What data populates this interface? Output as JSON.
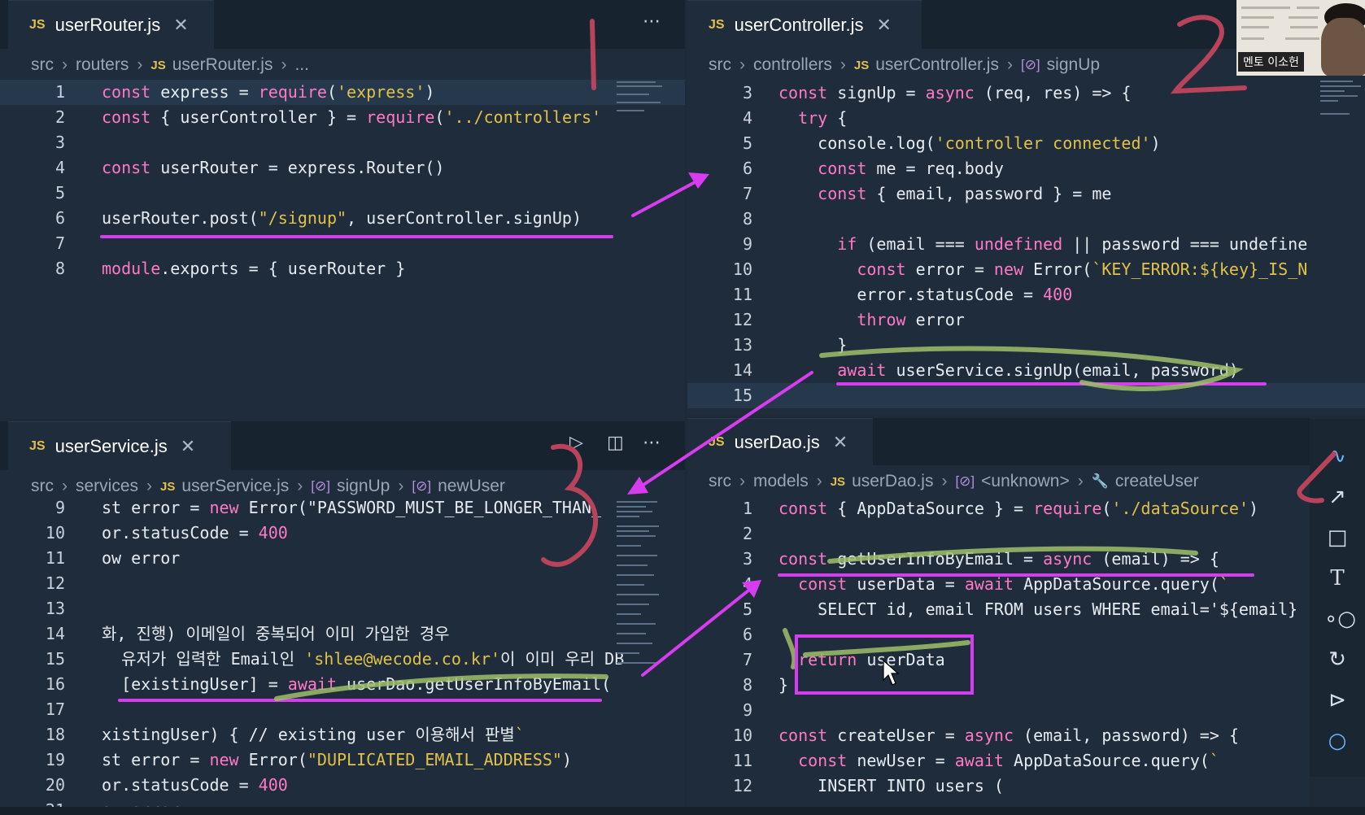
{
  "colors": {
    "keyword": "#ff79c6",
    "string": "#e2c14a",
    "func": "#ffb86c",
    "plain": "#e6ebf1",
    "comment": "#6aa1e0",
    "number": "#ff79c6",
    "annotation": "#d83cf0"
  },
  "pane1": {
    "tab": {
      "icon": "JS",
      "label": "userRouter.js"
    },
    "more_icon": "more-icon",
    "breadcrumb": [
      "src",
      "routers",
      "userRouter.js",
      "..."
    ],
    "lines": [
      {
        "n": "1",
        "t": "const express = require('express')"
      },
      {
        "n": "2",
        "t": "const { userController } = require('../controllers'"
      },
      {
        "n": "3",
        "t": ""
      },
      {
        "n": "4",
        "t": "const userRouter = express.Router()"
      },
      {
        "n": "5",
        "t": ""
      },
      {
        "n": "6",
        "t": "userRouter.post(\"/signup\", userController.signUp)"
      },
      {
        "n": "7",
        "t": ""
      },
      {
        "n": "8",
        "t": "module.exports = { userRouter }"
      }
    ]
  },
  "pane2": {
    "tab": {
      "icon": "JS",
      "label": "userController.js"
    },
    "breadcrumb": [
      "src",
      "controllers",
      "userController.js",
      "signUp"
    ],
    "lines": [
      {
        "n": "3",
        "t": "const signUp = async (req, res) => {"
      },
      {
        "n": "4",
        "t": "  try {"
      },
      {
        "n": "5",
        "t": "    console.log('controller connected')"
      },
      {
        "n": "6",
        "t": "    const me = req.body"
      },
      {
        "n": "7",
        "t": "    const { email, password } = me"
      },
      {
        "n": "8",
        "t": ""
      },
      {
        "n": "9",
        "t": "      if (email === undefined || password === undefine"
      },
      {
        "n": "10",
        "t": "        const error = new Error(`KEY_ERROR:${key}_IS_N"
      },
      {
        "n": "11",
        "t": "        error.statusCode = 400"
      },
      {
        "n": "12",
        "t": "        throw error"
      },
      {
        "n": "13",
        "t": "      }"
      },
      {
        "n": "14",
        "t": "      await userService.signUp(email, password)"
      },
      {
        "n": "15",
        "t": ""
      }
    ]
  },
  "pane3": {
    "tab": {
      "icon": "JS",
      "label": "userService.js"
    },
    "breadcrumb": [
      "src",
      "services",
      "userService.js",
      "signUp",
      "newUser"
    ],
    "lines": [
      {
        "n": "9",
        "t": "st error = new Error(\"PASSWORD_MUST_BE_LONGER_THAN_"
      },
      {
        "n": "10",
        "t": "or.statusCode = 400"
      },
      {
        "n": "11",
        "t": "ow error"
      },
      {
        "n": "12",
        "t": ""
      },
      {
        "n": "13",
        "t": ""
      },
      {
        "n": "14",
        "t": "화, 진행) 이메일이 중복되어 이미 가입한 경우"
      },
      {
        "n": "15",
        "t": "  유저가 입력한 Email인 'shlee@wecode.co.kr'이 이미 우리 DB"
      },
      {
        "n": "16",
        "t": "  [existingUser] = await userDao.getUserInfoByEmail("
      },
      {
        "n": "17",
        "t": ""
      },
      {
        "n": "18",
        "t": "xistingUser) { // existing user 이용해서 판별`"
      },
      {
        "n": "19",
        "t": "st error = new Error(\"DUPLICATED_EMAIL_ADDRESS\")"
      },
      {
        "n": "20",
        "t": "or.statusCode = 400"
      },
      {
        "n": "21",
        "t": "ow error"
      }
    ]
  },
  "pane4": {
    "tab": {
      "icon": "JS",
      "label": "userDao.js"
    },
    "breadcrumb": [
      "src",
      "models",
      "userDao.js",
      "<unknown>",
      "createUser"
    ],
    "lines": [
      {
        "n": "1",
        "t": "const { AppDataSource } = require('./dataSource')"
      },
      {
        "n": "2",
        "t": ""
      },
      {
        "n": "3",
        "t": "const getUserInfoByEmail = async (email) => {"
      },
      {
        "n": "4",
        "t": "  const userData = await AppDataSource.query(`"
      },
      {
        "n": "5",
        "t": "    SELECT id, email FROM users WHERE email='${email}"
      },
      {
        "n": "6",
        "t": ""
      },
      {
        "n": "7",
        "t": "  return userData"
      },
      {
        "n": "8",
        "t": "}"
      },
      {
        "n": "9",
        "t": ""
      },
      {
        "n": "10",
        "t": "const createUser = async (email, password) => {"
      },
      {
        "n": "11",
        "t": "  const newUser = await AppDataSource.query(`"
      },
      {
        "n": "12",
        "t": "    INSERT INTO users ("
      }
    ]
  },
  "annotations": {
    "n1": "1",
    "n2": "2",
    "n3": "3"
  },
  "webcam": {
    "name_tag": "멘토 이소헌"
  },
  "tools": [
    "pen-icon",
    "arrow-icon",
    "rectangle-icon",
    "text-icon",
    "link-icon",
    "refresh-icon",
    "play-icon",
    "circle-icon"
  ]
}
